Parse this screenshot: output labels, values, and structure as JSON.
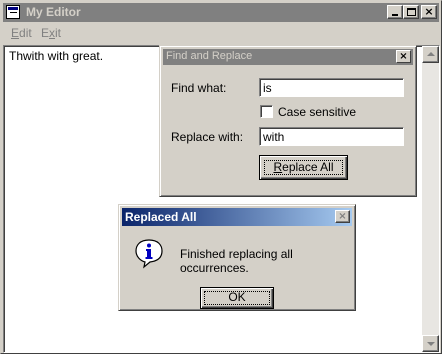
{
  "window": {
    "title": "My Editor",
    "minimize_glyph": "_",
    "close_glyph": "×"
  },
  "menu": {
    "edit": {
      "mnemonic": "E",
      "rest": "dit"
    },
    "exit": {
      "mnemonic": "x",
      "pre": "E",
      "rest": "it"
    }
  },
  "editor": {
    "text": "Thwith with great."
  },
  "find_dialog": {
    "title": "Find and Replace",
    "find_label": "Find what:",
    "find_value": "is",
    "case_label": "Case sensitive",
    "case_checked": false,
    "replace_label": "Replace with:",
    "replace_value": "with",
    "replace_all_mnemonic": "R",
    "replace_all_rest": "eplace All",
    "close_glyph": "×"
  },
  "message_box": {
    "title": "Replaced All",
    "message": "Finished replacing all occurrences.",
    "ok_label": "OK",
    "close_glyph": "×",
    "icon": "info-icon"
  },
  "colors": {
    "inactive_title": "#808080",
    "active_title_start": "#0a246a",
    "active_title_end": "#a6caf0",
    "face": "#d4d0c8"
  }
}
